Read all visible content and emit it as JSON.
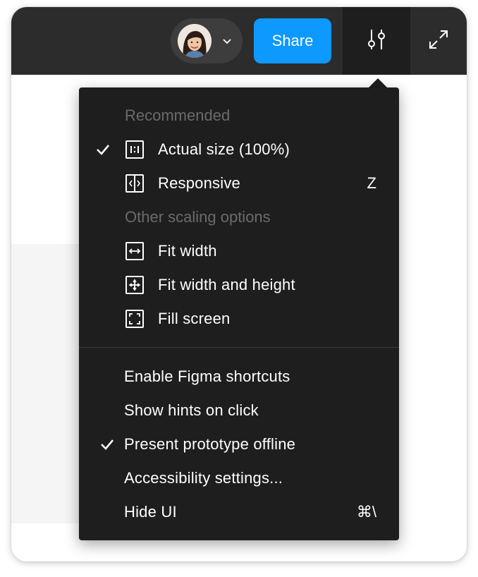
{
  "toolbar": {
    "share_label": "Share",
    "share_color": "#0d99ff",
    "avatar_icon": "user-avatar",
    "chevron_icon": "chevron-down-icon",
    "settings_icon": "sliders-icon",
    "expand_icon": "expand-icon"
  },
  "menu": {
    "sections": {
      "recommended": "Recommended",
      "other": "Other scaling options"
    },
    "scaling_items": [
      {
        "label": "Actual size (100%)",
        "icon": "actual-size-icon",
        "checked": true,
        "shortcut": ""
      },
      {
        "label": "Responsive",
        "icon": "responsive-icon",
        "checked": false,
        "shortcut": "Z"
      },
      {
        "label": "Fit width",
        "icon": "fit-width-icon",
        "checked": false,
        "shortcut": ""
      },
      {
        "label": "Fit width and height",
        "icon": "fit-width-height-icon",
        "checked": false,
        "shortcut": ""
      },
      {
        "label": "Fill screen",
        "icon": "fill-screen-icon",
        "checked": false,
        "shortcut": ""
      }
    ],
    "option_items": [
      {
        "label": "Enable Figma shortcuts",
        "checked": false,
        "shortcut": ""
      },
      {
        "label": "Show hints on click",
        "checked": false,
        "shortcut": ""
      },
      {
        "label": "Present prototype offline",
        "checked": true,
        "shortcut": ""
      },
      {
        "label": "Accessibility settings...",
        "checked": false,
        "shortcut": ""
      },
      {
        "label": "Hide UI",
        "checked": false,
        "shortcut": "⌘\\"
      }
    ]
  }
}
